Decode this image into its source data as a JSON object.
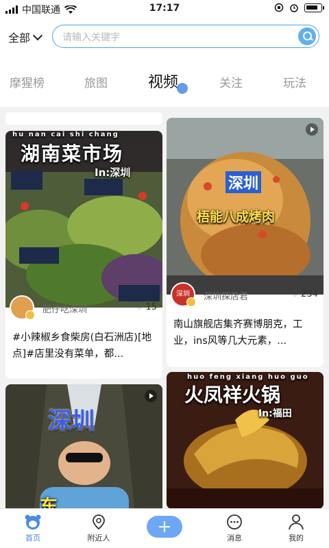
{
  "status_bar": {
    "carrier": "中国联通",
    "time": "17:17"
  },
  "header": {
    "scope_label": "全部",
    "search_placeholder": "请输入关键字",
    "tabs": [
      {
        "label": "摩猩榜"
      },
      {
        "label": "旅图"
      },
      {
        "label": "视频"
      },
      {
        "label": "关注"
      },
      {
        "label": "玩法"
      }
    ],
    "active_tab": "视频"
  },
  "feed": {
    "cards": [
      {
        "overlay_title": "湖南菜市场",
        "overlay_subtitle": "In:深圳",
        "overlay_pinyin": "hu nan cai shi chang",
        "author": "肥仔吃深圳",
        "likes": "15",
        "description": "#小辣椒乡食柴房(白石洲店)[地点]#店里没有菜单，都..."
      },
      {
        "overlay_title": "深圳",
        "overlay_subtitle": "梧能八成烤肉",
        "author": "深圳探店君",
        "author_avatar_text": "深圳",
        "likes": "234",
        "description": "南山旗舰店集齐赛博朋克，工业，ins风等几大元素，..."
      },
      {
        "overlay_title": "深圳",
        "overlay_subtitle": "东",
        "author": "",
        "likes": "",
        "description": ""
      },
      {
        "overlay_title": "火凤祥火锅",
        "overlay_subtitle": "In:福田",
        "overlay_pinyin": "huo feng xiang huo guo",
        "author": "",
        "likes": "",
        "description": ""
      }
    ]
  },
  "bottom_nav": {
    "items": [
      {
        "label": "首页"
      },
      {
        "label": "附近人"
      },
      {
        "label": "消息"
      },
      {
        "label": "我的"
      }
    ]
  },
  "colors": {
    "accent": "#4a8be6",
    "search_border": "#4aa3e8"
  }
}
